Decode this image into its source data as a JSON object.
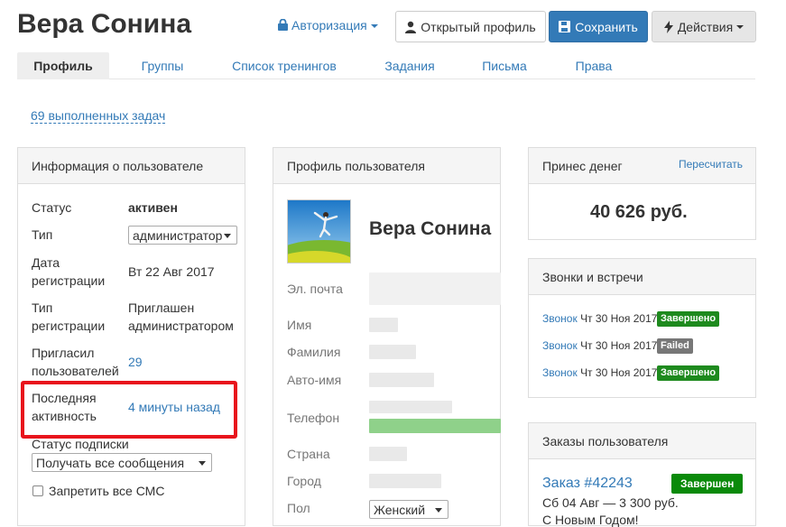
{
  "header": {
    "title": "Вера Сонина",
    "auth_label": "Авторизация",
    "open_profile_label": "Открытый профиль",
    "save_label": "Сохранить",
    "actions_label": "Действия"
  },
  "tabs": [
    {
      "label": "Профиль",
      "active": true
    },
    {
      "label": "Группы"
    },
    {
      "label": "Список тренингов"
    },
    {
      "label": "Задания"
    },
    {
      "label": "Письма"
    },
    {
      "label": "Права"
    }
  ],
  "tasks_link": "69 выполненных задач",
  "user_info": {
    "heading": "Информация о пользователе",
    "status_label": "Статус",
    "status_value": "активен",
    "type_label": "Тип",
    "type_value": "администратор",
    "reg_date_label_1": "Дата",
    "reg_date_label_2": "регистрации",
    "reg_date_value": "Вт 22 Авг 2017",
    "reg_type_label_1": "Тип",
    "reg_type_label_2": "регистрации",
    "reg_type_value_1": "Приглашен",
    "reg_type_value_2": "администратором",
    "invited_label_1": "Пригласил",
    "invited_label_2": "пользователей",
    "invited_value": "29",
    "last_activity_label_1": "Последняя",
    "last_activity_label_2": "активность",
    "last_activity_value": "4 минуты назад",
    "subscription_label": "Статус подписки",
    "subscription_value": "Получать все сообщения",
    "sms_label": "Запретить все СМС"
  },
  "profile": {
    "heading": "Профиль пользователя",
    "name": "Вера Сонина",
    "email_label": "Эл. почта",
    "first_name_label": "Имя",
    "last_name_label": "Фамилия",
    "auto_name_label": "Авто-имя",
    "phone_label": "Телефон",
    "country_label": "Страна",
    "city_label": "Город",
    "gender_label": "Пол",
    "gender_value": "Женский"
  },
  "money": {
    "heading": "Принес денег",
    "recalc_label": "Пересчитать",
    "amount": "40 626 руб."
  },
  "calls": {
    "heading": "Звонки и встречи",
    "items": [
      {
        "kind": "Звонок",
        "date": "Чт 30 Ноя 2017",
        "status": "Завершено",
        "status_color": "#1e8a1e"
      },
      {
        "kind": "Звонок",
        "date": "Чт 30 Ноя 2017",
        "status": "Failed",
        "status_color": "#777777"
      },
      {
        "kind": "Звонок",
        "date": "Чт 30 Ноя 2017",
        "status": "Завершено",
        "status_color": "#1e8a1e"
      }
    ]
  },
  "orders": {
    "heading": "Заказы пользователя",
    "order_link": "Заказ #42243",
    "order_status": "Завершен",
    "order_date_sum": "Сб 04 Авг — 3 300 руб.",
    "order_note": "С Новым Годом!"
  },
  "colors": {
    "accent": "#337ab7",
    "highlight": "#e8141c",
    "success": "#1e8a1e"
  }
}
